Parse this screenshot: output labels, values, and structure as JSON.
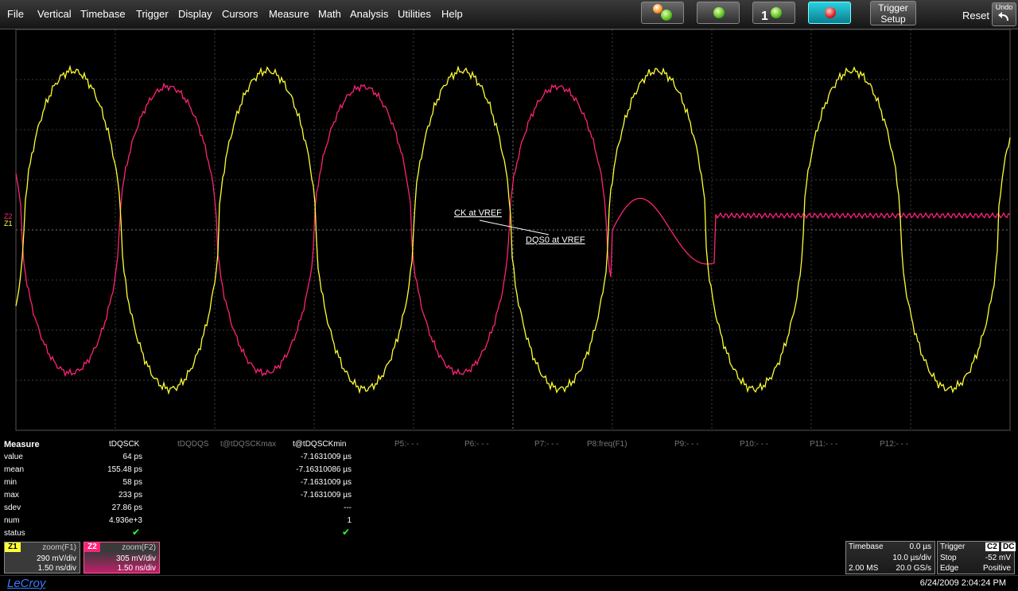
{
  "menu": [
    "File",
    "Vertical",
    "Timebase",
    "Trigger",
    "Display",
    "Cursors",
    "Measure",
    "Math",
    "Analysis",
    "Utilities",
    "Help"
  ],
  "toolbar": {
    "buttons": [
      {
        "icon": "alarm-clock-icon",
        "led": "green"
      },
      {
        "icon": "run-icon",
        "led": "green"
      },
      {
        "icon": "single-icon",
        "led": "green",
        "label": "1"
      },
      {
        "icon": "stop-icon",
        "led": "red"
      }
    ],
    "trigger_setup": [
      "Trigger",
      "Setup"
    ],
    "reset": "Reset",
    "undo": "Undo"
  },
  "traces": {
    "z1_color": "#ffff33",
    "z2_color": "#ff2277",
    "z1_label": "Z1",
    "z2_label": "Z2",
    "annotations": {
      "ck": "CK at VREF",
      "dqs": "DQS0 at VREF"
    }
  },
  "measure": {
    "title": "Measure",
    "row_labels": [
      "value",
      "mean",
      "min",
      "max",
      "sdev",
      "num",
      "status"
    ],
    "params": [
      {
        "name": "tDQSCK",
        "values": [
          "64 ps",
          "155.48 ps",
          "58 ps",
          "233 ps",
          "27.86 ps",
          "4.936e+3"
        ],
        "status_ok": true
      },
      {
        "name": "tDQDQS",
        "values": [],
        "status_ok": false
      },
      {
        "name": "t@tDQSCKmax",
        "values": [],
        "status_ok": false
      },
      {
        "name": "t@tDQSCKmin",
        "values": [
          "-7.1631009 µs",
          "-7.16310086 µs",
          "-7.1631009 µs",
          "-7.1631009 µs",
          "---",
          "1"
        ],
        "status_ok": true
      },
      {
        "name": "P5:- - -"
      },
      {
        "name": "P6:- - -"
      },
      {
        "name": "P7:- - -"
      },
      {
        "name": "P8:freq(F1)"
      },
      {
        "name": "P9:- - -"
      },
      {
        "name": "P10:- - -"
      },
      {
        "name": "P11:- - -"
      },
      {
        "name": "P12:- - -"
      }
    ]
  },
  "zoom": [
    {
      "tag": "Z1",
      "title": "zoom(F1)",
      "vdiv": "290 mV/div",
      "tdiv": "1.50 ns/div"
    },
    {
      "tag": "Z2",
      "title": "zoom(F2)",
      "vdiv": "305 mV/div",
      "tdiv": "1.50 ns/div"
    }
  ],
  "timebase": {
    "label": "Timebase",
    "delay": "0.0 µs",
    "tdiv": "10.0 µs/div",
    "samples": "2.00 MS",
    "rate": "20.0 GS/s"
  },
  "trigger": {
    "label": "Trigger",
    "badge": "C2",
    "coupling": "DC",
    "mode": "Stop",
    "level": "-52 mV",
    "type": "Edge",
    "slope": "Positive"
  },
  "footer": {
    "brand": "LeCroy",
    "datetime": "6/24/2009 2:04:24 PM"
  }
}
